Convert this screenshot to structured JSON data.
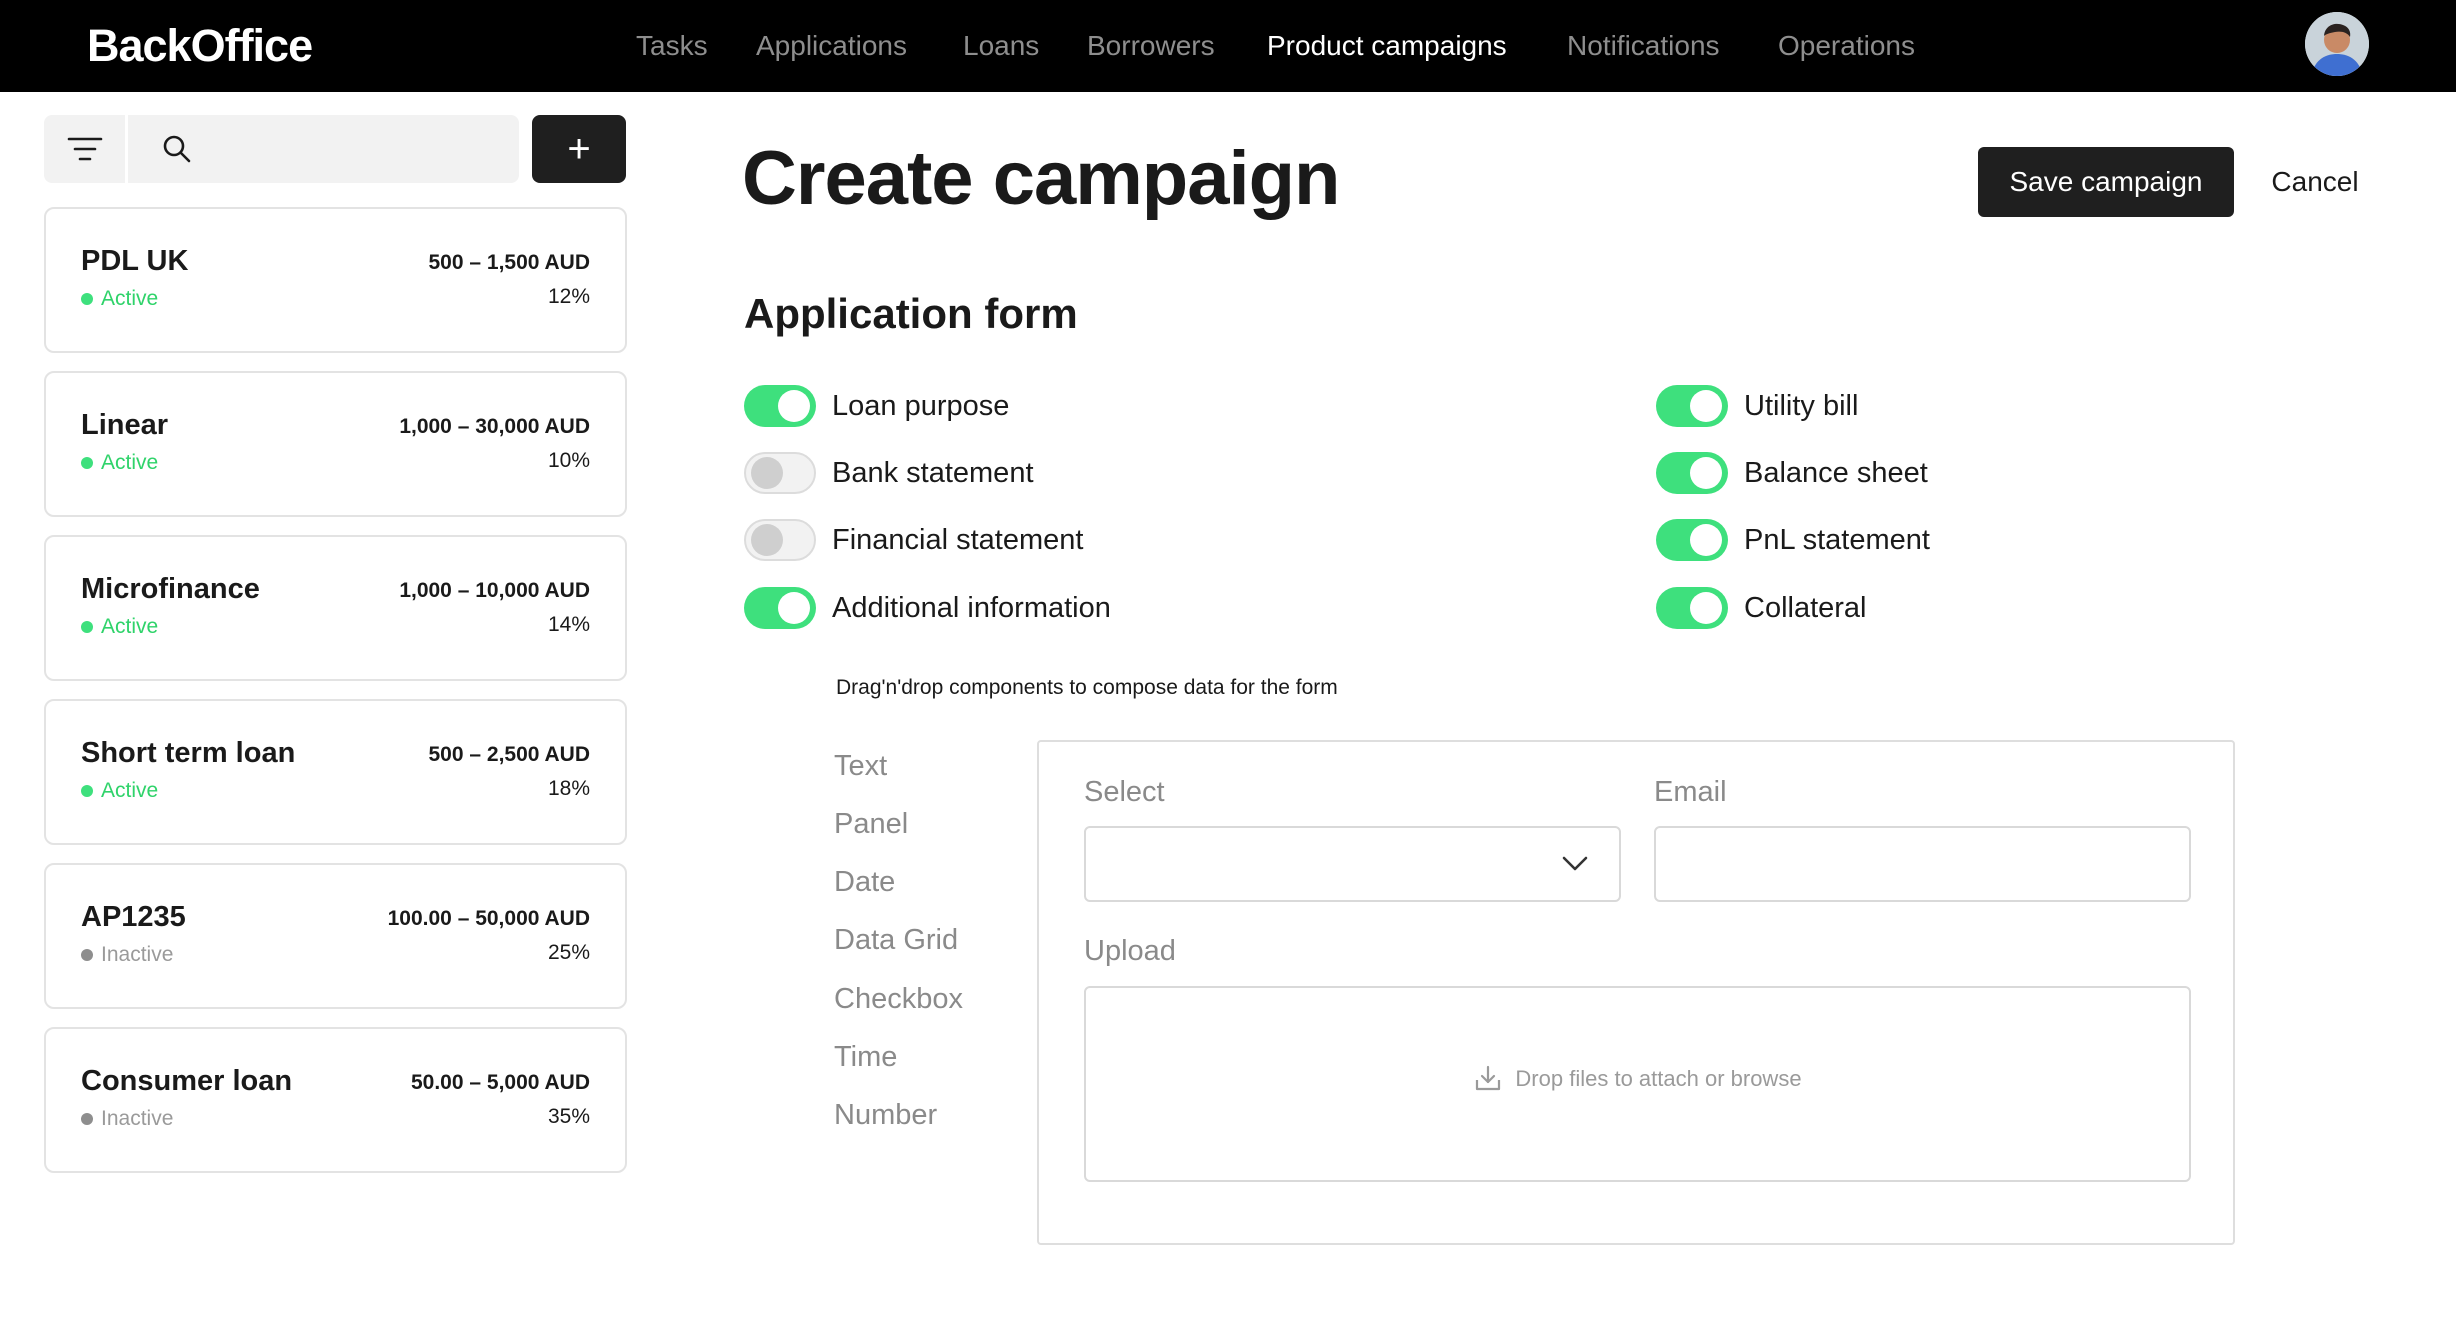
{
  "header": {
    "logo": "BackOffice",
    "nav": [
      "Tasks",
      "Applications",
      "Loans",
      "Borrowers",
      "Product campaigns",
      "Notifications",
      "Operations"
    ],
    "active_nav": "Product campaigns"
  },
  "sidebar": {
    "search": {
      "value": "",
      "placeholder": ""
    },
    "add_label": "+",
    "campaigns": [
      {
        "name": "PDL UK",
        "status": "Active",
        "range": "500 – 1,500 AUD",
        "rate": "12%"
      },
      {
        "name": "Linear",
        "status": "Active",
        "range": "1,000 – 30,000 AUD",
        "rate": "10%"
      },
      {
        "name": "Microfinance",
        "status": "Active",
        "range": "1,000 – 10,000 AUD",
        "rate": "14%"
      },
      {
        "name": "Short term loan",
        "status": "Active",
        "range": "500 – 2,500 AUD",
        "rate": "18%"
      },
      {
        "name": "AP1235",
        "status": "Inactive",
        "range": "100.00 – 50,000 AUD",
        "rate": "25%"
      },
      {
        "name": "Consumer loan",
        "status": "Inactive",
        "range": "50.00 – 5,000 AUD",
        "rate": "35%"
      }
    ]
  },
  "main": {
    "title": "Create campaign",
    "save_label": "Save campaign",
    "cancel_label": "Cancel",
    "section_title": "Application form",
    "toggles_left": [
      {
        "label": "Loan purpose",
        "on": true
      },
      {
        "label": "Bank statement",
        "on": false
      },
      {
        "label": "Financial statement",
        "on": false
      },
      {
        "label": "Additional information",
        "on": true
      }
    ],
    "toggles_right": [
      {
        "label": "Utility bill",
        "on": true
      },
      {
        "label": "Balance sheet",
        "on": true
      },
      {
        "label": "PnL statement",
        "on": true
      },
      {
        "label": "Collateral",
        "on": true
      }
    ],
    "hint": "Drag'n'drop components to compose data for the form",
    "components": [
      "Text",
      "Panel",
      "Date",
      "Data Grid",
      "Checkbox",
      "Time",
      "Number"
    ],
    "builder": {
      "select_label": "Select",
      "select_value": "",
      "email_label": "Email",
      "email_value": "",
      "upload_label": "Upload",
      "upload_hint": "Drop files to attach or browse"
    }
  },
  "colors": {
    "active": "#3ee07d",
    "inactive": "#8e8e8e",
    "active_status_text": "#2fd36a",
    "inactive_status_text": "#9a9a9a"
  }
}
